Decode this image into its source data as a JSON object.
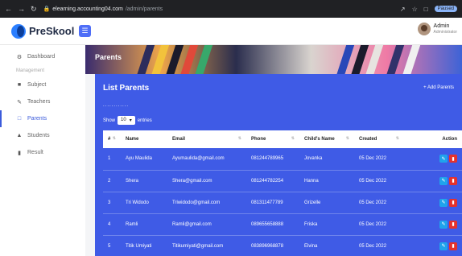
{
  "browser": {
    "url_host": "elearning.accounting04.com",
    "url_path": "/admin/parents",
    "paused": "Paused"
  },
  "app": {
    "name": "PreSkool"
  },
  "user": {
    "name": "Admin",
    "role": "Administrator"
  },
  "sidebar": {
    "dashboard": "Dashboard",
    "section_label": "Management",
    "items": [
      "Subject",
      "Teachers",
      "Parents",
      "Students",
      "Result"
    ],
    "active": "Parents"
  },
  "banner": {
    "title": "Parents"
  },
  "card": {
    "title": "List Parents",
    "add_label": "+ Add Parents",
    "dots": "............",
    "show_label": "Show",
    "entries_value": "10",
    "entries_label": "entries"
  },
  "table": {
    "headers": [
      "#",
      "Name",
      "Email",
      "Phone",
      "Child's Name",
      "Created",
      "Action"
    ],
    "rows": [
      [
        "1",
        "Ayu Maulida",
        "Ayumaulida@gmail.com",
        "081244789965",
        "Jovanka",
        "05 Dec 2022"
      ],
      [
        "2",
        "Shera",
        "Shera@gmail.com",
        "081244782254",
        "Hanna",
        "05 Dec 2022"
      ],
      [
        "3",
        "Tri Widodo",
        "Triwidodo@gmail.com",
        "081311477789",
        "Grizelle",
        "05 Dec 2022"
      ],
      [
        "4",
        "Ramli",
        "Ramli@gmail.com",
        "089655658888",
        "Friska",
        "05 Dec 2022"
      ],
      [
        "5",
        "Titik Umiyati",
        "Titikumiyati@gmail.com",
        "083896968878",
        "Elvina",
        "05 Dec 2022"
      ]
    ]
  },
  "colors": {
    "accent": "#3f5be6",
    "edit": "#1fa3ec",
    "delete": "#e5322d"
  }
}
